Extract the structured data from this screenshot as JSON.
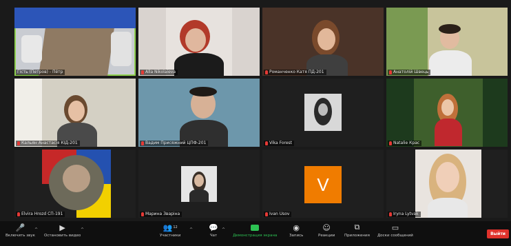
{
  "participants": [
    {
      "name": "Гість (Петров) - Пётр",
      "muted": false
    },
    {
      "name": "Alla Nikolaieva",
      "muted": true
    },
    {
      "name": "Романченко Катя ПД-201",
      "muted": true
    },
    {
      "name": "Анатолій Швець",
      "muted": true
    },
    {
      "name": "Кальян Анастасія КІД-201",
      "muted": true
    },
    {
      "name": "Вадим Присяжний ЦПФ-201",
      "muted": true
    },
    {
      "name": "Vika Forest",
      "muted": true
    },
    {
      "name": "Natalie Крас",
      "muted": true
    },
    {
      "name": "Elvira Hrozd СП-191",
      "muted": true
    },
    {
      "name": "Марина Зваріна",
      "muted": true
    },
    {
      "name": "Ivan Usov",
      "muted": true
    },
    {
      "name": "Iryna Lytvak",
      "muted": true
    }
  ],
  "avatar_letter": "V",
  "toolbar": {
    "mute": "Включить звук",
    "video": "Остановить видео",
    "participants": "Участники",
    "participants_count": "12",
    "chat": "Чат",
    "share": "Демонстрация экрана",
    "record": "Запись",
    "reactions": "Реакции",
    "apps": "Приложения",
    "whiteboard": "Доски сообщений",
    "end": "Выйти"
  },
  "colors": {
    "active_border": "#8fd14f",
    "share_green": "#2dc253",
    "end_red": "#e0322c",
    "avatar_orange": "#f07c00"
  }
}
